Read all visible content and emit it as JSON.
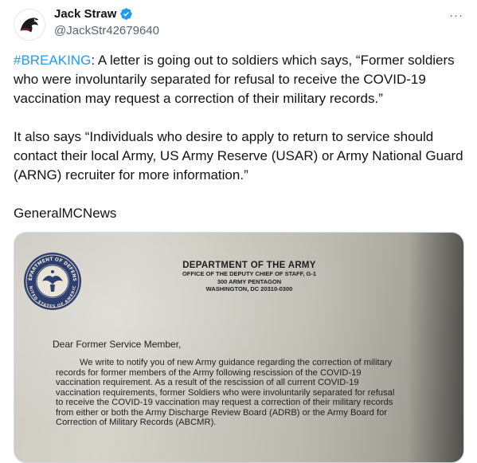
{
  "user": {
    "display_name": "Jack Straw",
    "handle": "@JackStr42679640",
    "verified": true,
    "avatar_icon": "raven-icon"
  },
  "more_icon": "···",
  "tweet": {
    "hashtag": "#BREAKING",
    "para1_rest": ": A letter is going out to soldiers which says, “Former soldiers who were involuntarily separated for refusal to receive the COVID-19 vaccination may request a correction of their military records.”",
    "para2": "It also says “Individuals who desire to apply to return to service should contact their local Army, US Army Reserve (USAR) or Army National Guard (ARNG) recruiter for more information.”",
    "para3": "GeneralMCNews"
  },
  "letter": {
    "department": "DEPARTMENT OF THE ARMY",
    "office": "OFFICE OF THE DEPUTY CHIEF OF STAFF, G-1",
    "address1": "300 ARMY PENTAGON",
    "address2": "WASHINGTON, DC 20310-0300",
    "salutation": "Dear Former Service Member,",
    "lines": [
      "We write to notify you of new Army guidance regarding the correction of military",
      "records for former members of the Army following rescission of the COVID-19",
      "vaccination requirement.  As a result of the rescission of all current COVID-19",
      "vaccination requirements, former Soldiers who were involuntarily separated for refusal",
      "to receive the COVID-19 vaccination may request a correction of their military records",
      "from either or both the Army Discharge Review Board (ADRB) or the Army Board for",
      "Correction of Military Records (ABCMR)."
    ],
    "seal_text_top": "DEPARTMENT OF DEFENSE",
    "seal_text_bottom": "UNITED STATES OF AMERICA"
  },
  "colors": {
    "link": "#1d9bf0",
    "verified": "#1d9bf0",
    "muted": "#536471"
  }
}
